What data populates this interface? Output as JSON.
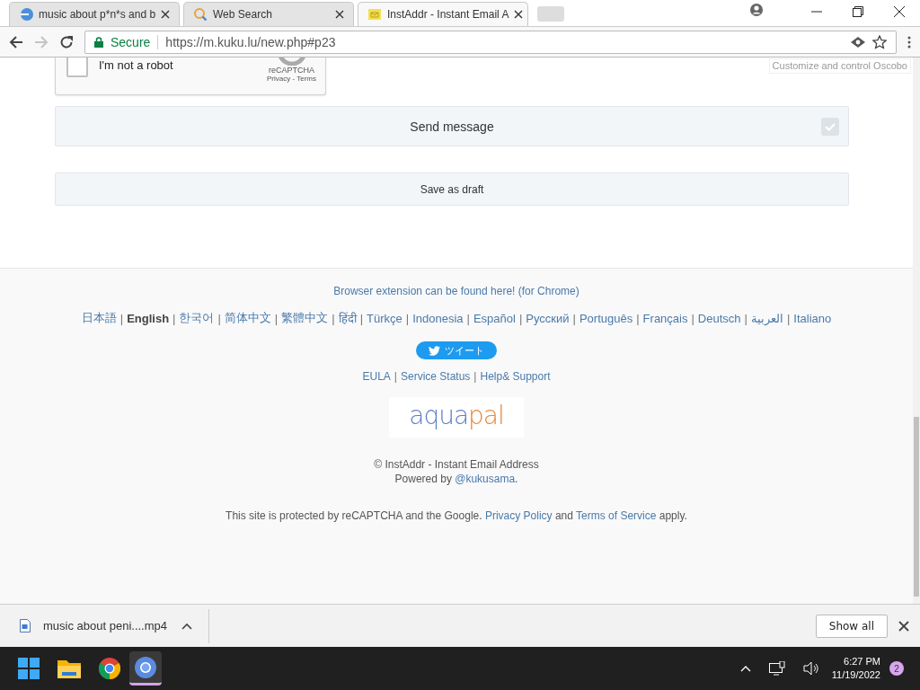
{
  "tabs": [
    {
      "title": "music about p*n*s and b",
      "selected": false
    },
    {
      "title": "Web Search",
      "selected": false
    },
    {
      "title": "InstAddr - Instant Email A",
      "selected": true
    }
  ],
  "address_bar": {
    "secure_label": "Secure",
    "url": "https://m.kuku.lu/new.php#p23"
  },
  "tooltip": "Customize and control Oscobo",
  "captcha": {
    "label": "I'm not a robot",
    "checked": false,
    "brand": "reCAPTCHA",
    "links": "Privacy - Terms"
  },
  "buttons": [
    {
      "label": "Send message",
      "kind": "primary"
    },
    {
      "label": "Save as draft",
      "kind": "secondary"
    }
  ],
  "footer": {
    "extension_link": "Browser extension can be found here! (for Chrome)",
    "separator": "|",
    "languages": [
      {
        "label": "日本語",
        "selected": false
      },
      {
        "label": "English",
        "selected": true
      },
      {
        "label": "한국어",
        "selected": false
      },
      {
        "label": "简体中文",
        "selected": false
      },
      {
        "label": "繁體中文",
        "selected": false
      },
      {
        "label": "हिंदी",
        "selected": false
      },
      {
        "label": "Türkçe",
        "selected": false
      },
      {
        "label": "Indonesia",
        "selected": false
      },
      {
        "label": "Español",
        "selected": false
      },
      {
        "label": "Русский",
        "selected": false
      },
      {
        "label": "Português",
        "selected": false
      },
      {
        "label": "Français",
        "selected": false
      },
      {
        "label": "Deutsch",
        "selected": false
      },
      {
        "label": "العربية",
        "selected": false
      },
      {
        "label": "Italiano",
        "selected": false
      }
    ],
    "tweet_button": "ツイート",
    "links": [
      "EULA",
      "Service Status",
      "Help& Support"
    ],
    "logo": {
      "part_1": "aqua",
      "part_2": "pal"
    },
    "copyright": "© InstAddr - Instant Email Address",
    "powered": {
      "prefix": "Powered by ",
      "link": "@kukusama",
      "suffix": "."
    },
    "recaptcha_notice": {
      "text_1": "This site is protected by reCAPTCHA and the Google. ",
      "link_1": "Privacy Policy",
      "text_2": " and ",
      "link_2": "Terms of Service",
      "text_3": " apply."
    }
  },
  "download_bar": {
    "file": "music about peni....mp4",
    "show_all": "Show all"
  },
  "taskbar": {
    "time": "6:27 PM",
    "date": "11/19/2022",
    "notifications": "2"
  }
}
